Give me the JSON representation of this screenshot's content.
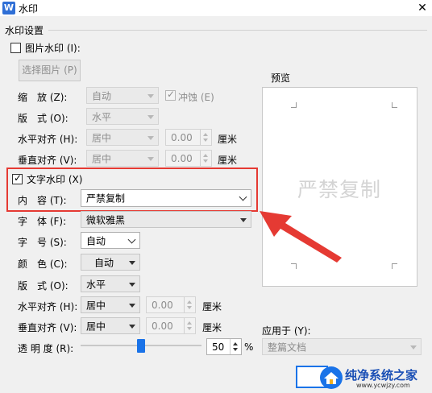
{
  "window": {
    "title": "水印",
    "app_icon": "W"
  },
  "group": {
    "title": "水印设置"
  },
  "picture": {
    "checkbox_label": "图片水印 (I):",
    "select_button": "选择图片 (P)",
    "scale_label": "缩　放 (Z):",
    "scale_value": "自动",
    "washout_label": "冲蚀 (E)",
    "layout_label": "版　式 (O):",
    "layout_value": "水平",
    "halign_label": "水平对齐 (H):",
    "halign_value": "居中",
    "halign_offset": "0.00",
    "halign_unit": "厘米",
    "valign_label": "垂直对齐 (V):",
    "valign_value": "居中",
    "valign_offset": "0.00",
    "valign_unit": "厘米"
  },
  "text": {
    "checkbox_label": "文字水印 (X)",
    "content_label": "内　容 (T):",
    "content_value": "严禁复制",
    "font_label": "字　体 (F):",
    "font_value": "微软雅黑",
    "size_label": "字　号 (S):",
    "size_value": "自动",
    "color_label": "颜　色 (C):",
    "color_value": "自动",
    "layout_label": "版　式 (O):",
    "layout_value": "水平",
    "halign_label": "水平对齐 (H):",
    "halign_value": "居中",
    "halign_offset": "0.00",
    "halign_unit": "厘米",
    "valign_label": "垂直对齐 (V):",
    "valign_value": "居中",
    "valign_offset": "0.00",
    "valign_unit": "厘米",
    "transparency_label": "透 明 度 (R):",
    "transparency_value": "50",
    "transparency_unit": "%"
  },
  "preview": {
    "label": "预览",
    "watermark": "严禁复制"
  },
  "apply": {
    "label": "应用于 (Y):",
    "value": "整篇文档"
  },
  "logo": {
    "name": "纯净系统之家",
    "url": "www.ycwjzy.com"
  },
  "colors": {
    "highlight": "#e53a33",
    "accent": "#1a73e8"
  }
}
